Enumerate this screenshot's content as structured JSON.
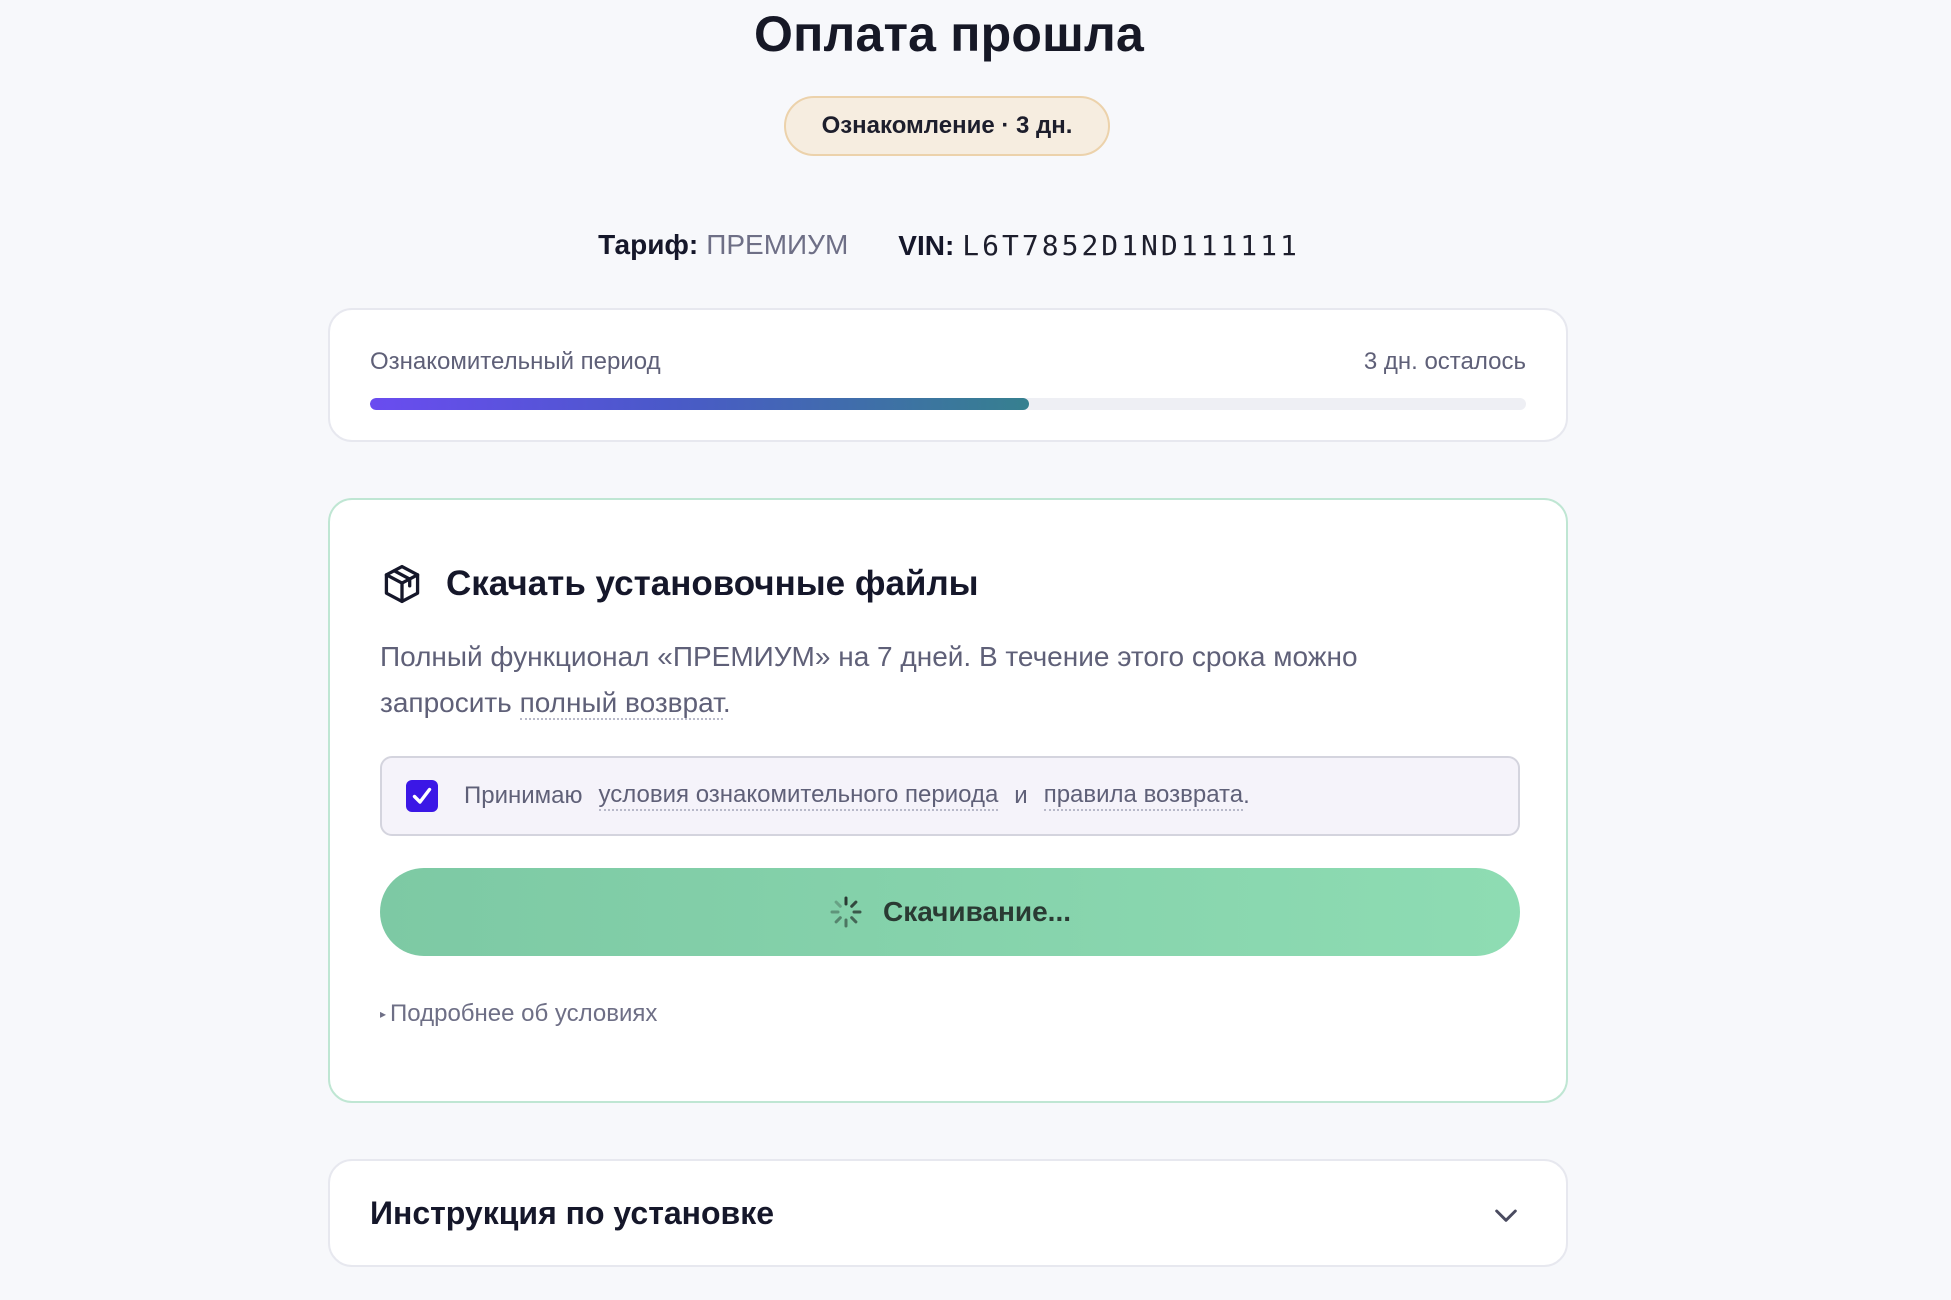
{
  "header": {
    "title": "Оплата прошла",
    "badge": "Ознакомление · 3 дн."
  },
  "meta": {
    "plan_label": "Тариф:",
    "plan_value": "ПРЕМИУМ",
    "vin_label": "VIN:",
    "vin_value": "L6T7852D1ND111111"
  },
  "trial": {
    "label": "Ознакомительный период",
    "remaining": "3 дн. осталось",
    "progress_fraction": 0.57,
    "colors": {
      "start": "#6a4cf0",
      "end": "#36808f"
    }
  },
  "download": {
    "icon": "package-icon",
    "title": "Скачать установочные файлы",
    "description_text": "Полный функционал «ПРЕМИУМ» на 7 дней. В течение этого срока можно запросить ",
    "refund_link": "полный возврат",
    "description_end": ".",
    "consent": {
      "checked": true,
      "prefix": "Принимаю",
      "terms_link": "условия ознакомительного периода",
      "and": "и",
      "refund_rules_link": "правила возврата",
      "suffix": "."
    },
    "button_label": "Скачивание...",
    "button_icon": "spinner-icon",
    "details_label": "Подробнее об условиях"
  },
  "instructions": {
    "title": "Инструкция по установке",
    "icon": "chevron-down-icon"
  }
}
